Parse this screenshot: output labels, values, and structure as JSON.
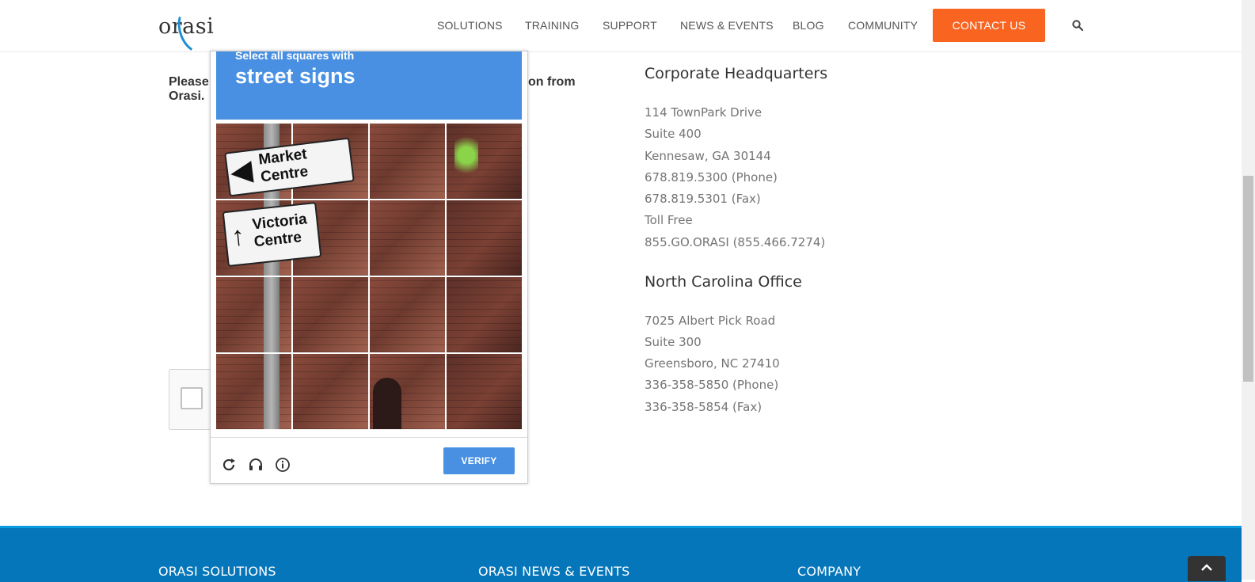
{
  "nav": {
    "logo_text": "orasi",
    "items": [
      "SOLUTIONS",
      "TRAINING",
      "SUPPORT",
      "NEWS & EVENTS",
      "BLOG",
      "COMMUNITY"
    ],
    "contact_label": "CONTACT US",
    "search_icon": "search-icon"
  },
  "form": {
    "text_left": "Please",
    "text_left_line2": "Orasi.",
    "text_right": "on from"
  },
  "captcha": {
    "instruction": "Select all squares with",
    "object": "street signs",
    "sign1": "Market\nCentre",
    "sign2": "Victoria\nCentre",
    "verify_label": "VERIFY",
    "icons": [
      "reload-icon",
      "audio-icon",
      "info-icon"
    ]
  },
  "offices": {
    "hq_title": "Corporate Headquarters",
    "hq_lines": [
      "114 TownPark Drive",
      "Suite 400",
      "Kennesaw, GA 30144",
      "678.819.5300 (Phone)",
      "678.819.5301 (Fax)",
      "Toll Free",
      "855.GO.ORASI (855.466.7274)"
    ],
    "nc_title": "North Carolina Office",
    "nc_lines": [
      "7025 Albert Pick Road",
      "Suite 300",
      "Greensboro, NC 27410",
      "336-358-5850 (Phone)",
      "336-358-5854 (Fax)"
    ]
  },
  "footer": {
    "col1": "ORASI SOLUTIONS",
    "col2": "ORASI NEWS & EVENTS",
    "col3": "COMPANY"
  },
  "colors": {
    "accent_orange": "#f96521",
    "captcha_blue": "#4a90e2",
    "footer_blue": "#0676ba"
  }
}
